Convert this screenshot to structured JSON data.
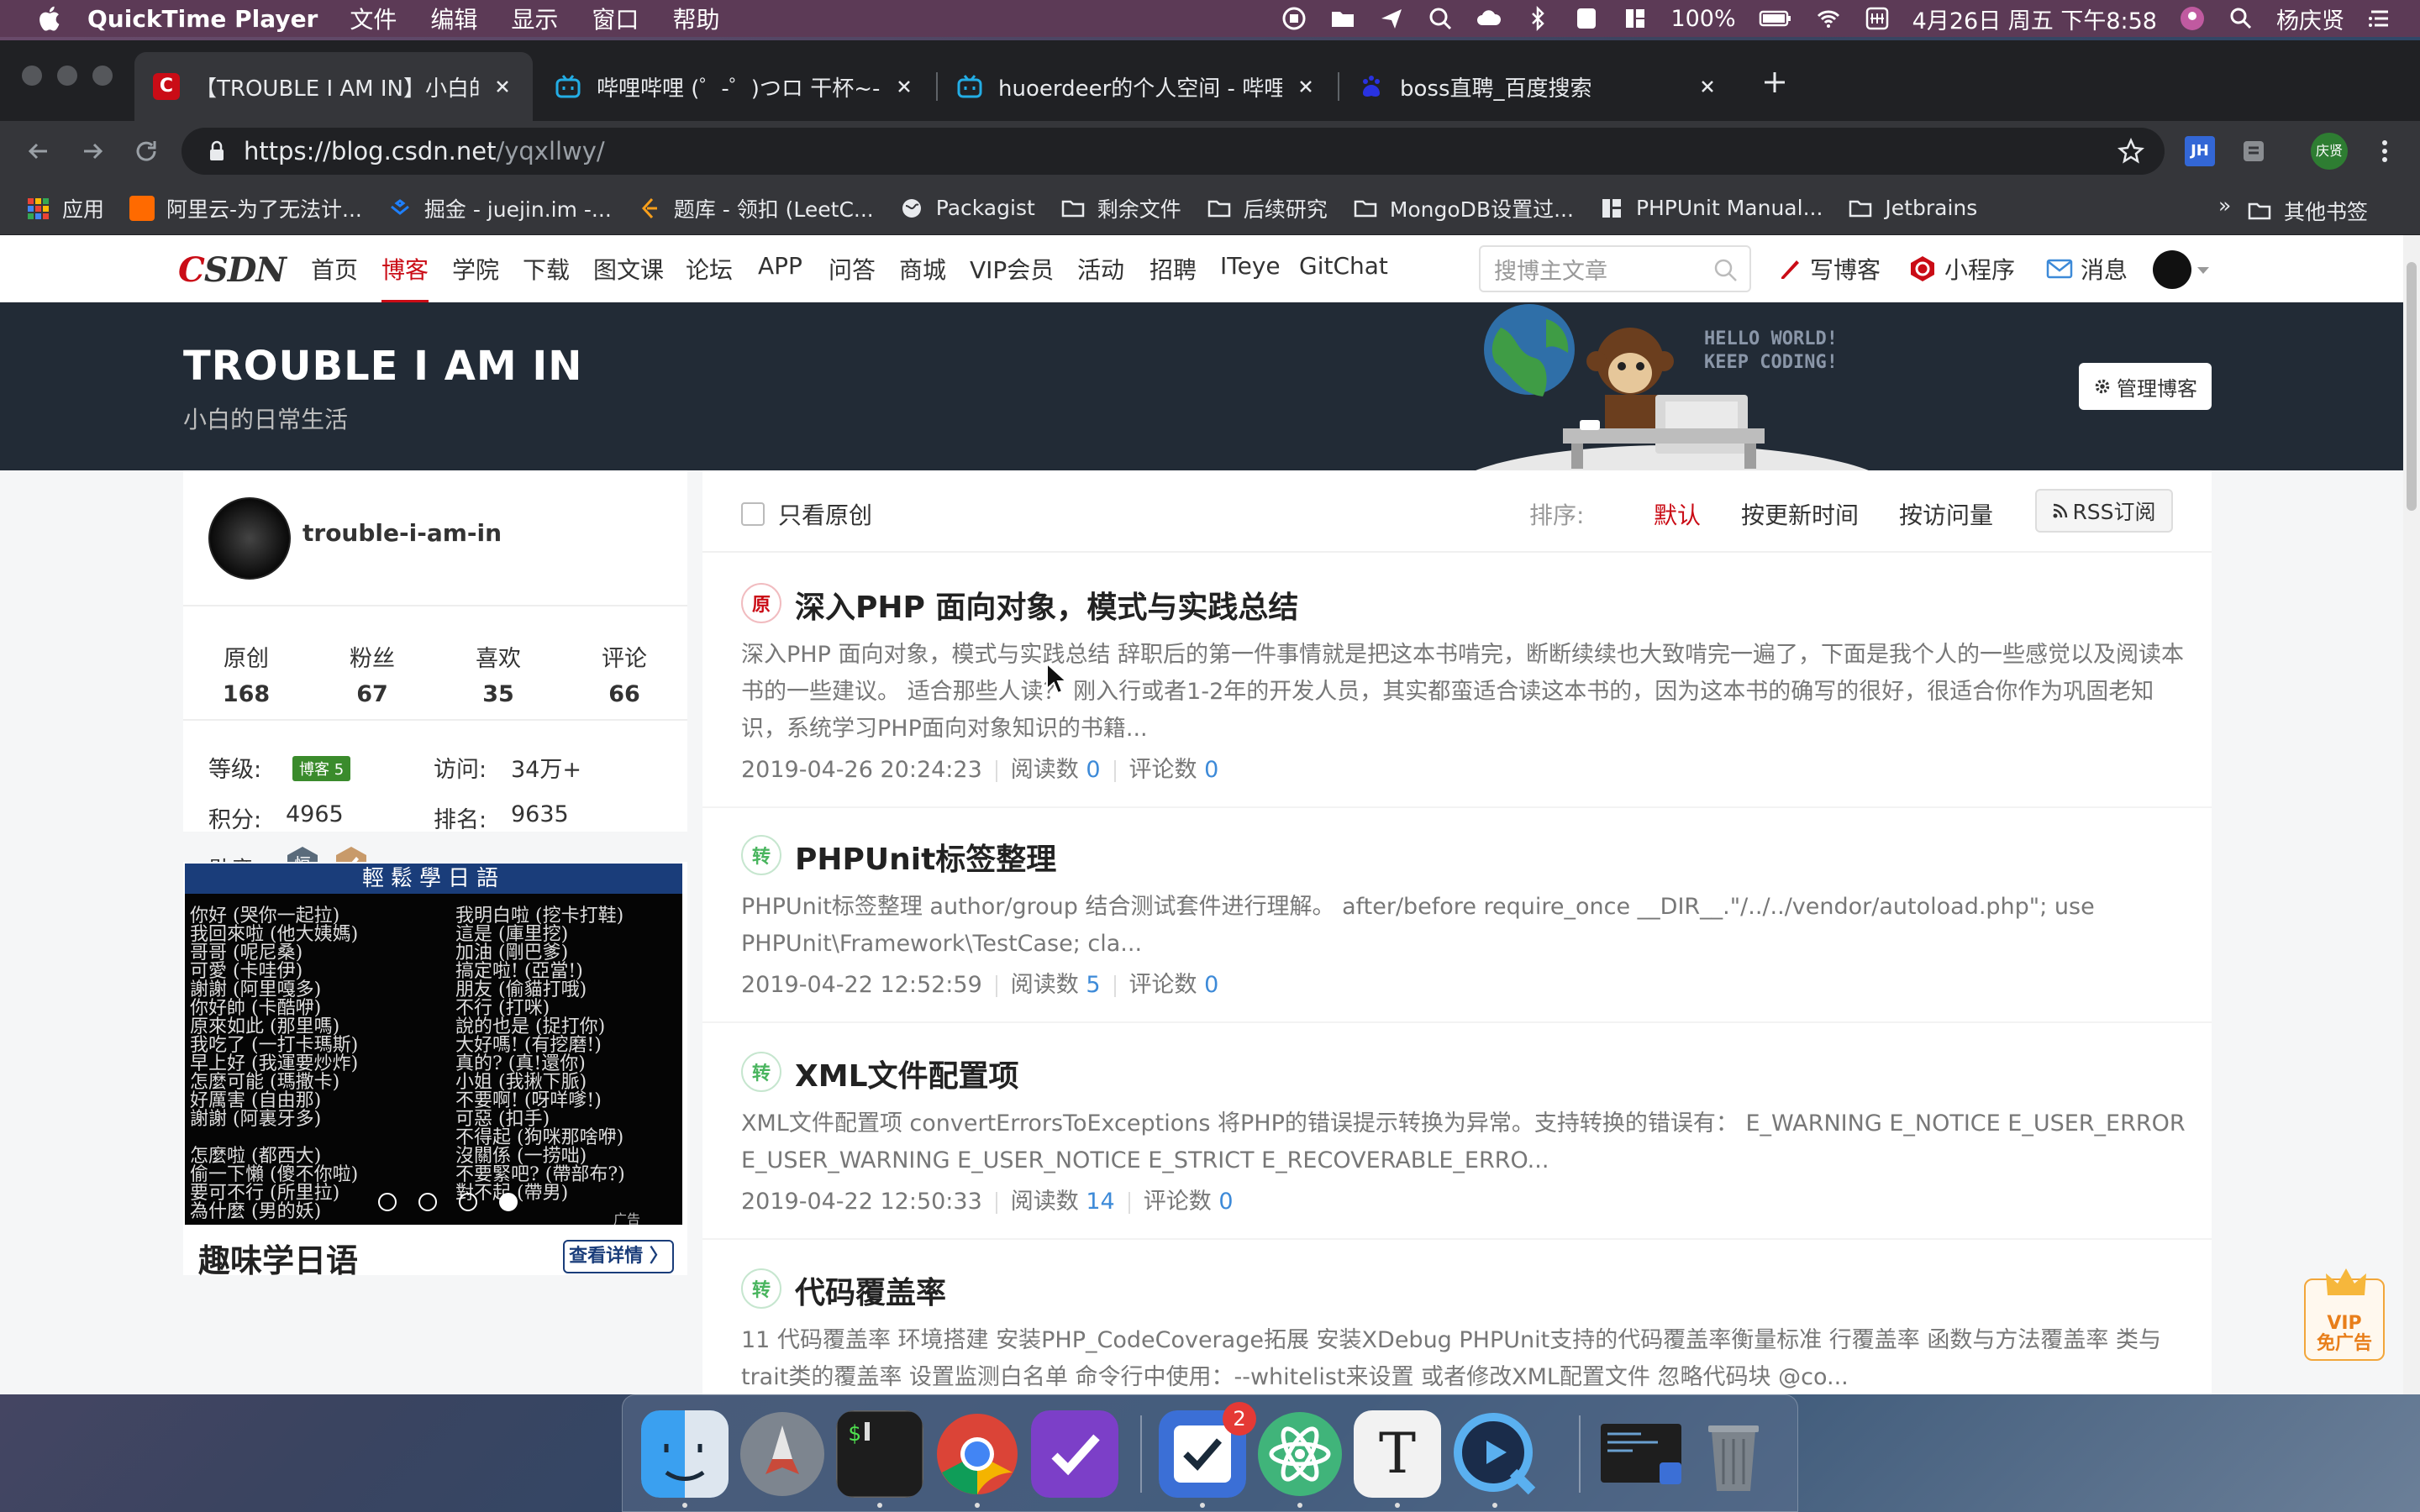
{
  "menubar": {
    "app_name": "QuickTime Player",
    "menus": [
      "文件",
      "编辑",
      "显示",
      "窗口",
      "帮助"
    ],
    "battery": "100%",
    "datetime": "4月26日 周五 下午8:58",
    "user": "杨庆贤"
  },
  "tabs": [
    {
      "title": "【TROUBLE I AM IN】小白的日",
      "favicon_color": "#ca0c16",
      "favicon_icon": "csdn-icon"
    },
    {
      "title": "哔哩哔哩 (゜-゜)つロ 干杯~-bili",
      "favicon_color": "#23ade5",
      "favicon_icon": "bilibili-icon"
    },
    {
      "title": "huoerdeer的个人空间 - 哔哩哔哩",
      "favicon_color": "#23ade5",
      "favicon_icon": "bilibili-icon"
    },
    {
      "title": "boss直聘_百度搜索",
      "favicon_color": "#2932e1",
      "favicon_icon": "baidu-icon"
    }
  ],
  "address": {
    "host": "https://blog.csdn.net",
    "path": "/yqxllwy/"
  },
  "extensions": {
    "jh": "JH",
    "profile": "庆贤"
  },
  "bookmarks": [
    {
      "label": "应用",
      "color": "#4285f4"
    },
    {
      "label": "阿里云-为了无法计...",
      "color": "#ff6a00"
    },
    {
      "label": "掘金 - juejin.im -...",
      "color": "#1e80ff"
    },
    {
      "label": "题库 - 领扣 (LeetC...",
      "color": "#f89f1b"
    },
    {
      "label": "Packagist",
      "color": "#e8eaed"
    },
    {
      "label": "剩余文件",
      "color": "#e8eaed"
    },
    {
      "label": "后续研究",
      "color": "#e8eaed"
    },
    {
      "label": "MongoDB设置过...",
      "color": "#e8eaed"
    },
    {
      "label": "PHPUnit Manual...",
      "color": "#e8eaed"
    },
    {
      "label": "Jetbrains",
      "color": "#e8eaed"
    }
  ],
  "bookmarks_more": "»",
  "bookmarks_other": "其他书签",
  "csdn": {
    "logo_c": "C",
    "logo_rest": "SDN",
    "nav": [
      "首页",
      "博客",
      "学院",
      "下载",
      "图文课",
      "论坛",
      "APP",
      "问答",
      "商城",
      "VIP会员",
      "活动",
      "招聘",
      "ITeye",
      "GitChat"
    ],
    "active_nav": "博客",
    "search_placeholder": "搜博主文章",
    "write": "写博客",
    "miniapp": "小程序",
    "message": "消息"
  },
  "blog": {
    "title": "TROUBLE I AM IN",
    "subtitle": "小白的日常生活",
    "banner_text_1": "HELLO WORLD!",
    "banner_text_2": "KEEP CODING!",
    "manage": "管理博客"
  },
  "profile": {
    "username": "trouble-i-am-in",
    "stats": [
      {
        "label": "原创",
        "value": "168"
      },
      {
        "label": "粉丝",
        "value": "67"
      },
      {
        "label": "喜欢",
        "value": "35"
      },
      {
        "label": "评论",
        "value": "66"
      }
    ],
    "level_label": "等级:",
    "level_badge": "博客 5",
    "visits_label": "访问:",
    "visits": "34万+",
    "points_label": "积分:",
    "points": "4965",
    "rank_label": "排名:",
    "rank": "9635",
    "medals_label": "勋章:"
  },
  "ad": {
    "header": "輕鬆學日語",
    "lines_left": [
      "你好 (哭你一起拉)",
      "我回來啦 (他大姨媽)",
      "哥哥 (呢尼桑)",
      "可愛 (卡哇伊)",
      "謝謝 (阿里嘎多)",
      "你好帥 (卡酷咿)",
      "原來如此 (那里嗎)",
      "我吃了 (一打卡瑪斯)",
      "早上好 (我運要炒炸)",
      "怎麼可能 (瑪撒卡)",
      "好厲害 (自由那)",
      "謝謝 (阿裏牙多)",
      "",
      "怎麼啦 (都西大)",
      "偷一下懶 (傻不你啦)",
      "要可不行 (所里拉)",
      "為什麼 (男的妖)"
    ],
    "lines_right": [
      "我明白啦 (挖卡打鞋)",
      "這是 (庫里挖)",
      "加油 (剛巴爹)",
      "搞定啦! (亞當!)",
      "朋友 (偷貓打哦)",
      "不行 (打咪)",
      "說的也是 (捉打你)",
      "大好嗎! (有挖磨!)",
      "真的? (真!還你)",
      "小姐 (我揪下脈)",
      "不要啊! (呀咩嗲!)",
      "可惡 (扣手)",
      "不得起 (狗咪那啥咿)",
      "沒關係 (一捞咄)",
      "不要緊吧? (帶部布?)",
      "對不起 (帶男)"
    ],
    "title": "趣味学日语",
    "button": "查看详情 〉",
    "small": "广告"
  },
  "filter": {
    "only_original": "只看原创",
    "sort_label": "排序:",
    "sort_options": [
      "默认",
      "按更新时间",
      "按访问量"
    ],
    "active_sort": "默认",
    "rss": "RSS订阅"
  },
  "articles": [
    {
      "type": "原",
      "title": "深入PHP 面向对象，模式与实践总结",
      "desc": "深入PHP 面向对象，模式与实践总结 辞职后的第一件事情就是把这本书啃完，断断续续也大致啃完一遍了，下面是我个人的一些感觉以及阅读本书的一些建议。 适合那些人读？ 刚入行或者1-2年的开发人员，其实都蛮适合读这本书的，因为这本书的确写的很好，很适合你作为巩固老知识，系统学习PHP面向对象知识的书籍...",
      "date": "2019-04-26 20:24:23",
      "reads_label": "阅读数",
      "reads": "0",
      "comments_label": "评论数",
      "comments": "0"
    },
    {
      "type": "转",
      "title": "PHPUnit标签整理",
      "desc": "PHPUnit标签整理 author/group 结合测试套件进行理解。 after/before require_once __DIR__.\"/../../vendor/autoload.php\"; use PHPUnit\\Framework\\TestCase; cla...",
      "date": "2019-04-22 12:52:59",
      "reads_label": "阅读数",
      "reads": "5",
      "comments_label": "评论数",
      "comments": "0"
    },
    {
      "type": "转",
      "title": "XML文件配置项",
      "desc": "XML文件配置项 convertErrorsToExceptions 将PHP的错误提示转换为异常。支持转换的错误有： E_WARNING E_NOTICE E_USER_ERROR E_USER_WARNING E_USER_NOTICE E_STRICT E_RECOVERABLE_ERRO...",
      "date": "2019-04-22 12:50:33",
      "reads_label": "阅读数",
      "reads": "14",
      "comments_label": "评论数",
      "comments": "0"
    },
    {
      "type": "转",
      "title": "代码覆盖率",
      "desc": "11 代码覆盖率 环境搭建 安装PHP_CodeCoverage拓展 安装XDebug PHPUnit支持的代码覆盖率衡量标准 行覆盖率 函数与方法覆盖率 类与trait类的覆盖率 设置监测白名单 命令行中使用：--whitelist来设置 或者修改XML配置文件 忽略代码块 @co...",
      "date": "",
      "reads_label": "",
      "reads": "",
      "comments_label": "",
      "comments": ""
    }
  ],
  "vip": {
    "line1": "VIP",
    "line2": "免广告"
  },
  "dock": {
    "reminders_badge": "2",
    "typora_letter": "T"
  }
}
